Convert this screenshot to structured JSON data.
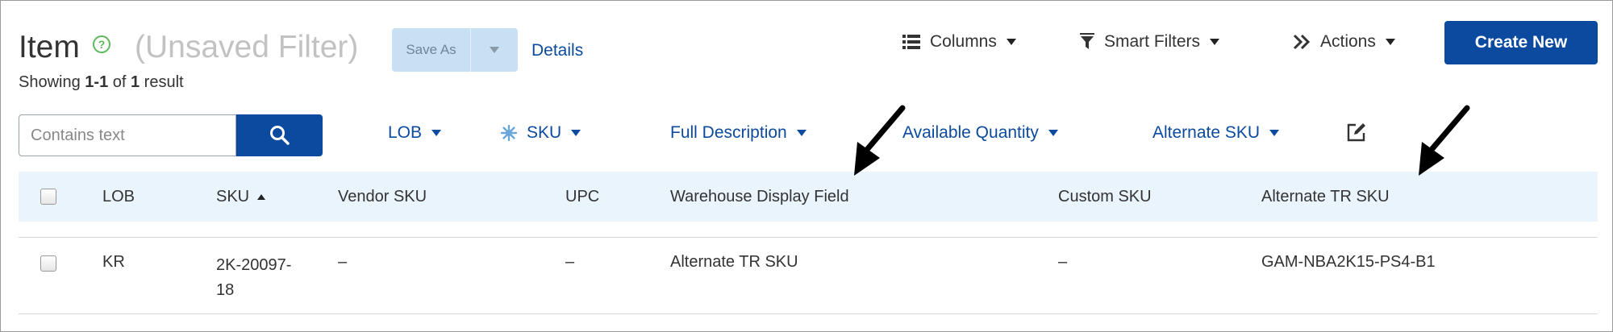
{
  "header": {
    "title": "Item",
    "help_icon": "question-circle-icon",
    "subtitle": "(Unsaved Filter)",
    "save_as_label": "Save As",
    "details_label": "Details",
    "result_prefix": "Showing ",
    "result_range": "1-1",
    "result_of": " of ",
    "result_total": "1",
    "result_suffix": " result"
  },
  "toolbar": {
    "columns_label": "Columns",
    "columns_icon": "list-icon",
    "smart_filters_label": "Smart Filters",
    "smart_filters_icon": "funnel-icon",
    "actions_label": "Actions",
    "actions_icon": "double-chevron-right-icon",
    "create_new_label": "Create New"
  },
  "search": {
    "placeholder": "Contains text",
    "button_icon": "search-icon"
  },
  "column_selectors": [
    {
      "label": "LOB"
    },
    {
      "label": "SKU",
      "icon": "gear-icon"
    },
    {
      "label": "Full Description"
    },
    {
      "label": "Available Quantity"
    },
    {
      "label": "Alternate SKU"
    }
  ],
  "table": {
    "headers": [
      "LOB",
      "SKU",
      "Vendor SKU",
      "UPC",
      "Warehouse Display Field",
      "Custom SKU",
      "Alternate TR SKU"
    ],
    "sorted_column": "SKU",
    "rows": [
      {
        "lob": "KR",
        "sku_line1": "2K-20097-",
        "sku_line2": "18",
        "vendor_sku": "–",
        "upc": "–",
        "warehouse_display": "Alternate TR SKU",
        "custom_sku": "–",
        "alternate_tr_sku": "GAM-NBA2K15-PS4-B1"
      }
    ]
  },
  "colors": {
    "primary": "#0b4a9e",
    "header_bg": "#e9f4fc",
    "help_green": "#5cb85c"
  }
}
